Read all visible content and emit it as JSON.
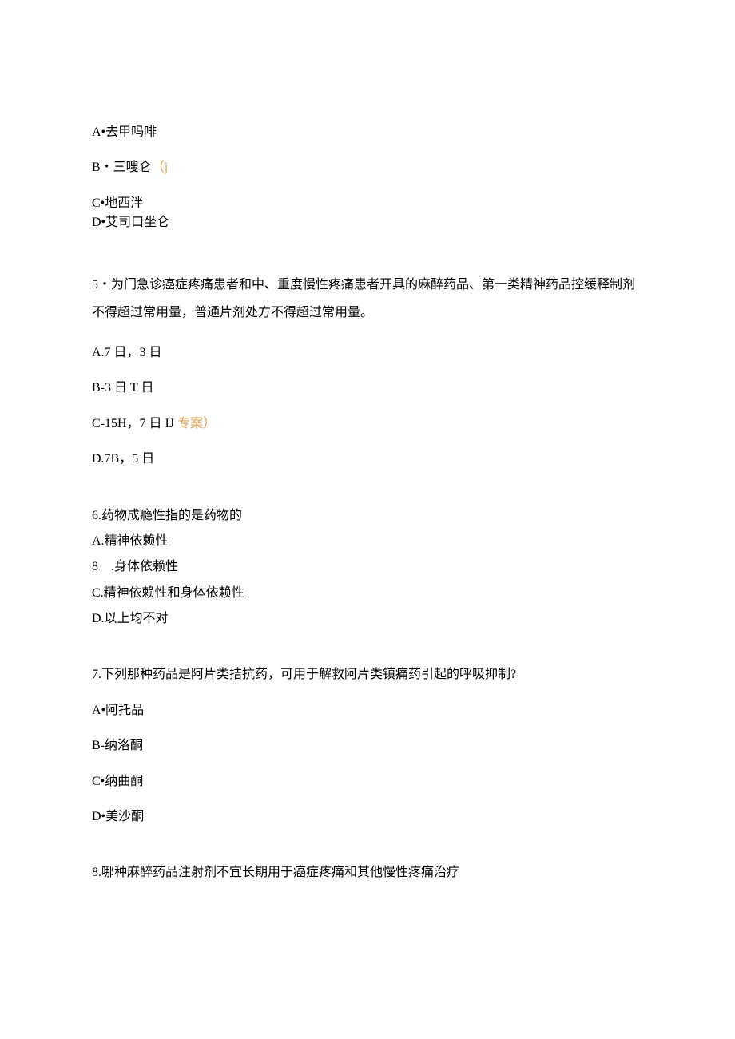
{
  "q4": {
    "optA": "A•去甲吗啡",
    "optB_pre": "B・三嗖仑",
    "optB_hl": "（j",
    "optC": "C•地西泮",
    "optD": "D•艾司口坐仑"
  },
  "q5": {
    "text": "5・为门急诊癌症疼痛患者和中、重度慢性疼痛患者开具的麻醉药品、第一类精神药品控缓释制剂不得超过常用量，普通片剂处方不得超过常用量。",
    "optA": "A.7 日，3 日",
    "optB": "B-3 日 T 日",
    "optC_pre": "C-15H，7 日 IJ ",
    "optC_hl": "专案）",
    "optD": "D.7B，5 日"
  },
  "q6": {
    "text": "6.药物成瘾性指的是药物的",
    "optA": "A.精神依赖性",
    "optB": "8　.身体依赖性",
    "optC": "C.精神依赖性和身体依赖性",
    "optD": "D.以上均不对"
  },
  "q7": {
    "text": "7.下列那种药品是阿片类拮抗药，可用于解救阿片类镇痛药引起的呼吸抑制?",
    "optA": "A•阿托品",
    "optB": "B-纳洛酮",
    "optC": "C•纳曲酮",
    "optD": "D•美沙酮"
  },
  "q8": {
    "text": "8.哪种麻醉药品注射剂不宜长期用于癌症疼痛和其他慢性疼痛治疗"
  }
}
